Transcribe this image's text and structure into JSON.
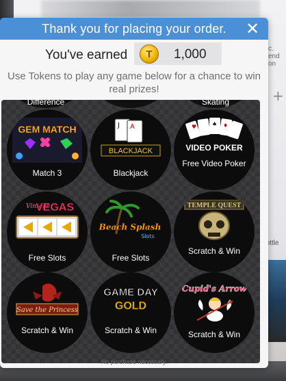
{
  "background": {
    "right_text": [
      "c.",
      "end",
      "on"
    ],
    "bottle_label": "Bottle"
  },
  "modal": {
    "title": "Thank you for placing your order.",
    "close_glyph": "✕",
    "earned_label": "You've earned",
    "token_symbol": "T",
    "token_amount": "1,000",
    "instructions": "Use Tokens to play any game below for a chance to win real prizes!",
    "footer_note": "No purchase necessary.",
    "partial_labels": [
      "Difference",
      "",
      "Skating"
    ],
    "games": [
      {
        "id": "match3",
        "title_art": "GEM MATCH",
        "label": "Match 3",
        "icon": "gem-match-icon"
      },
      {
        "id": "blackjack",
        "title_art": "BLACKJACK",
        "label": "Blackjack",
        "icon": "playing-cards-icon"
      },
      {
        "id": "videopoker",
        "title_art": "VIDEO POKER",
        "label": "Free Video Poker",
        "icon": "poker-hand-icon"
      },
      {
        "id": "vegas",
        "title_art": "VEGAS",
        "title_art_small": "Vintage",
        "label": "Free Slots",
        "icon": "slot-reels-icon"
      },
      {
        "id": "beach",
        "title_art": "Beach Splash",
        "title_art_small": "Slots",
        "label": "Free Slots",
        "icon": "palm-tree-icon"
      },
      {
        "id": "temple",
        "title_art": "TEMPLE QUEST",
        "label": "Scratch & Win",
        "icon": "skull-icon"
      },
      {
        "id": "princess",
        "title_art": "Save the Princess",
        "label": "Scratch & Win",
        "icon": "dragon-icon"
      },
      {
        "id": "gameday",
        "title_art": "GAME DAY",
        "title_art_small": "GOLD",
        "label": "Scratch & Win",
        "icon": "football-banner-icon"
      },
      {
        "id": "cupid",
        "title_art": "Cupid's Arrow",
        "label": "Scratch & Win",
        "icon": "cupid-icon"
      }
    ]
  },
  "colors": {
    "header_blue": "#4b8fd6",
    "panel_dark": "#333336",
    "coin_gold": "#f2b600"
  }
}
